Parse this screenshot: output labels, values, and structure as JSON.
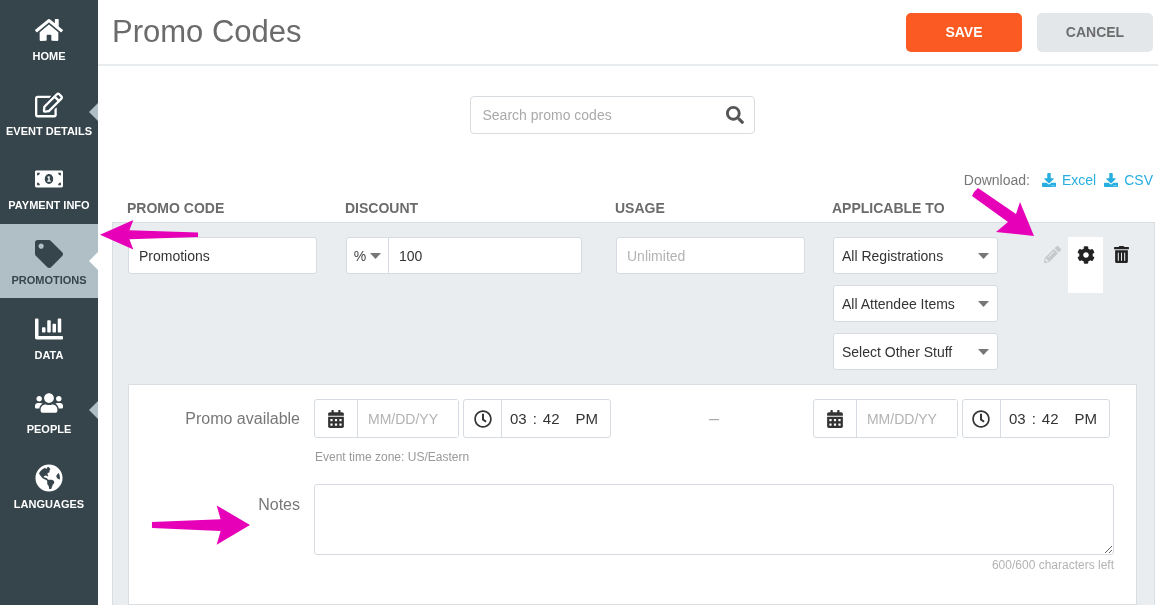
{
  "sidebar": {
    "items": [
      {
        "label": "HOME",
        "selected": false,
        "marker": false
      },
      {
        "label": "EVENT DETAILS",
        "selected": false,
        "marker": true
      },
      {
        "label": "PAYMENT INFO",
        "selected": false,
        "marker": false
      },
      {
        "label": "PROMOTIONS",
        "selected": true,
        "marker": true
      },
      {
        "label": "DATA",
        "selected": false,
        "marker": false
      },
      {
        "label": "PEOPLE",
        "selected": false,
        "marker": true
      },
      {
        "label": "LANGUAGES",
        "selected": false,
        "marker": false
      }
    ]
  },
  "header": {
    "title": "Promo Codes",
    "buttons": [
      {
        "label": "SAVE",
        "kind": "primary"
      },
      {
        "label": "CANCEL",
        "kind": "secondary"
      }
    ]
  },
  "search": {
    "placeholder": "Search promo codes"
  },
  "download": {
    "label": "Download:",
    "links": [
      "Excel",
      "CSV"
    ]
  },
  "table": {
    "columns": [
      "PROMO CODE",
      "DISCOUNT",
      "USAGE",
      "APPLICABLE TO"
    ],
    "row": {
      "code": "Promotions",
      "discount_type": "%",
      "discount": "100",
      "usage_placeholder": "Unlimited",
      "applicable": [
        "All Registrations",
        "All Attendee Items",
        "Select Other Stuff"
      ],
      "edit_disabled": true,
      "settings_expanded": true
    }
  },
  "details": {
    "availability": {
      "label": "Promo available",
      "start": {
        "date_placeholder": "MM/DD/YY",
        "hour": "03",
        "colon": ":",
        "minute": "42",
        "period": "PM"
      },
      "separator": "–",
      "end": {
        "date_placeholder": "MM/DD/YY",
        "hour": "03",
        "colon": ":",
        "minute": "42",
        "period": "PM"
      },
      "timezone_note": "Event time zone: US/Eastern"
    },
    "notes": {
      "label": "Notes",
      "counter": "600/600 characters left"
    }
  }
}
